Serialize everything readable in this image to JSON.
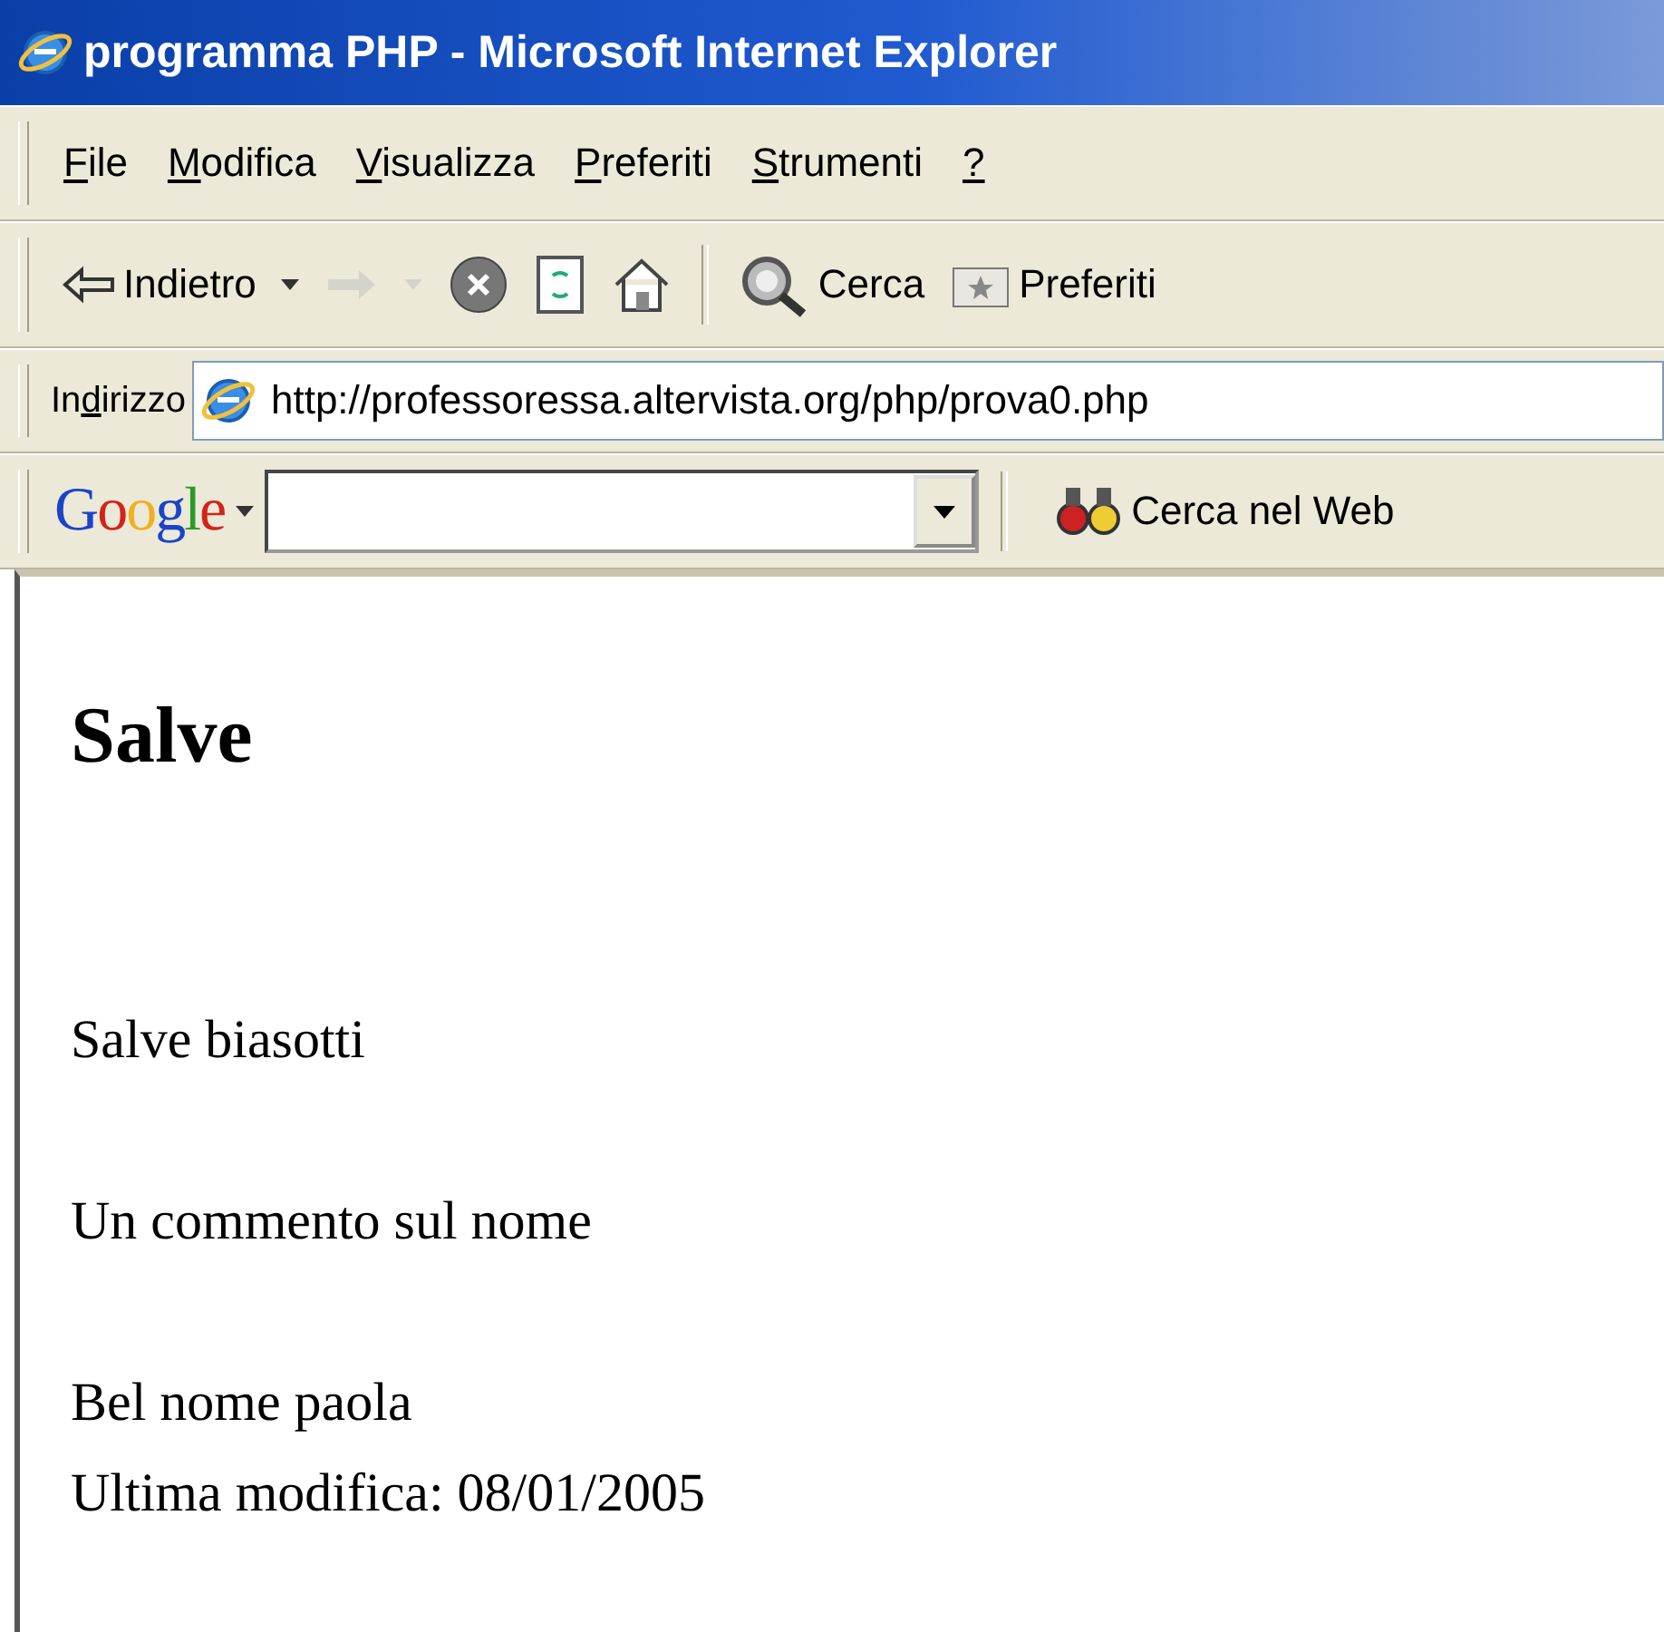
{
  "window": {
    "title": "programma PHP - Microsoft Internet Explorer"
  },
  "menu": [
    {
      "key": "F",
      "after": "ile"
    },
    {
      "key": "M",
      "after": "odifica"
    },
    {
      "key": "V",
      "after": "isualizza"
    },
    {
      "key": "P",
      "after": "referiti"
    },
    {
      "key": "S",
      "after": "trumenti"
    },
    {
      "key": "?"
    }
  ],
  "toolbar": [
    {
      "kind": "back",
      "label": "Indietro",
      "disabled": false,
      "dropdown": true
    },
    {
      "kind": "forward",
      "disabled": true,
      "dropdown": true
    },
    {
      "kind": "stop",
      "disabled": false,
      "dropdown": false
    },
    {
      "kind": "refresh",
      "disabled": false,
      "dropdown": false
    },
    {
      "kind": "home",
      "disabled": false,
      "dropdown": false
    },
    {
      "kind": "separator"
    },
    {
      "kind": "search",
      "label": "Cerca",
      "disabled": false,
      "dropdown": false
    },
    {
      "kind": "favorites",
      "label": "Preferiti",
      "disabled": false,
      "dropdown": false
    }
  ],
  "address_bar": {
    "label": {
      "before": "In",
      "key": "d",
      "after": "irizzo"
    },
    "url": "http://professoressa.altervista.org/php/prova0.php"
  },
  "google_bar": {
    "logo": "Google",
    "search_button": "Cerca nel Web"
  },
  "page": {
    "heading": "Salve",
    "paragraphs": [
      [
        "Salve biasotti"
      ],
      [
        "Un commento sul nome"
      ],
      [
        "Bel nome paola",
        "Ultima modifica: 08/01/2005"
      ]
    ]
  }
}
